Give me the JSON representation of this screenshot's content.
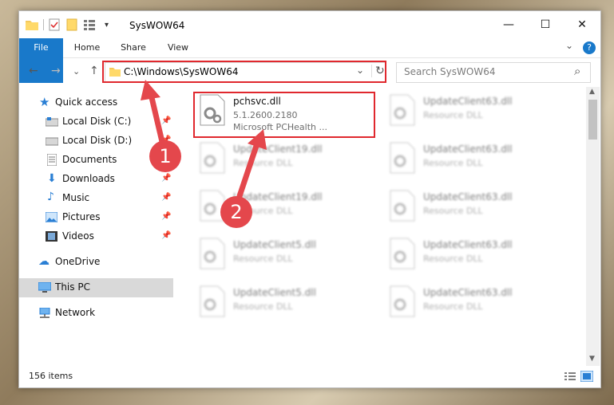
{
  "window": {
    "title": "SysWOW64",
    "minimize_icon": "—",
    "maximize_icon": "☐",
    "close_icon": "✕",
    "help_icon": "?"
  },
  "ribbon": {
    "tabs": [
      "File",
      "Home",
      "Share",
      "View"
    ],
    "expand_icon": "⌄"
  },
  "navigation": {
    "back_icon": "←",
    "forward_icon": "→",
    "recent_icon": "⌄",
    "up_icon": "↑",
    "address": "C:\\Windows\\SysWOW64",
    "address_dropdown": "⌄",
    "refresh_icon": "↻",
    "search_placeholder": "Search SysWOW64",
    "search_icon": "⌕"
  },
  "sidebar": {
    "items": [
      {
        "label": "Quick access",
        "pinned": false
      },
      {
        "label": "Local Disk (C:)",
        "pinned": true
      },
      {
        "label": "Local Disk (D:)",
        "pinned": true
      },
      {
        "label": "Documents",
        "pinned": true
      },
      {
        "label": "Downloads",
        "pinned": true
      },
      {
        "label": "Music",
        "pinned": true
      },
      {
        "label": "Pictures",
        "pinned": true
      },
      {
        "label": "Videos",
        "pinned": true
      },
      {
        "label": "OneDrive",
        "pinned": false
      },
      {
        "label": "This PC",
        "pinned": false
      },
      {
        "label": "Network",
        "pinned": false
      }
    ],
    "pin_icon": "📌"
  },
  "files": {
    "primary": {
      "name": "pchsvc.dll",
      "version": "5.1.2600.2180",
      "company": "Microsoft PCHealth ..."
    },
    "left_column": [
      {
        "name": "UpdateClient19.dll",
        "type": "Resource DLL"
      },
      {
        "name": "UpdateClient19.dll",
        "type": "Resource DLL"
      },
      {
        "name": "UpdateClient5.dll",
        "type": "Resource DLL"
      },
      {
        "name": "UpdateClient5.dll",
        "type": "Resource DLL"
      }
    ],
    "right_column": [
      {
        "name": "UpdateClient63.dll",
        "type": "Resource DLL"
      },
      {
        "name": "UpdateClient63.dll",
        "type": "Resource DLL"
      },
      {
        "name": "UpdateClient63.dll",
        "type": "Resource DLL"
      },
      {
        "name": "UpdateClient63.dll",
        "type": "Resource DLL"
      },
      {
        "name": "UpdateClient63.dll",
        "type": "Resource DLL"
      }
    ]
  },
  "status": {
    "count": "156 items"
  },
  "annotations": {
    "badge1": "1",
    "badge2": "2"
  },
  "colors": {
    "accent": "#1979ca",
    "highlight": "#e0282e",
    "badge": "#e4474c"
  }
}
